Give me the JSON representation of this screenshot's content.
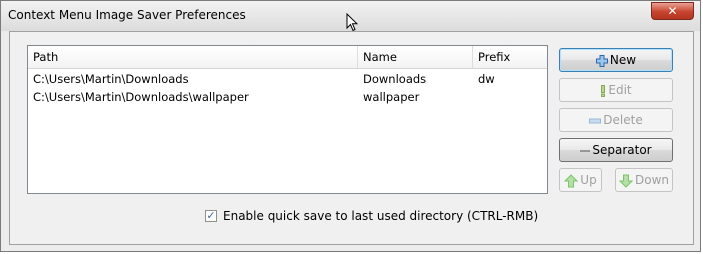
{
  "window": {
    "title": "Context Menu Image Saver Preferences",
    "close_label": "✕"
  },
  "list": {
    "columns": [
      "Path",
      "Name",
      "Prefix"
    ],
    "rows": [
      {
        "path": "C:\\Users\\Martin\\Downloads",
        "name": "Downloads",
        "prefix": "dw"
      },
      {
        "path": "C:\\Users\\Martin\\Downloads\\wallpaper",
        "name": "wallpaper",
        "prefix": ""
      }
    ]
  },
  "buttons": {
    "new": "New",
    "edit": "Edit",
    "delete": "Delete",
    "separator": "Separator",
    "up": "Up",
    "down": "Down"
  },
  "options": {
    "quick_save_label": "Enable quick save to last used directory (CTRL-RMB)",
    "quick_save_checked": true,
    "check_mark": "✓"
  },
  "colors": {
    "accent": "#3c7fb1",
    "close": "#c8442f",
    "arrow_green": "#7cc36b"
  }
}
